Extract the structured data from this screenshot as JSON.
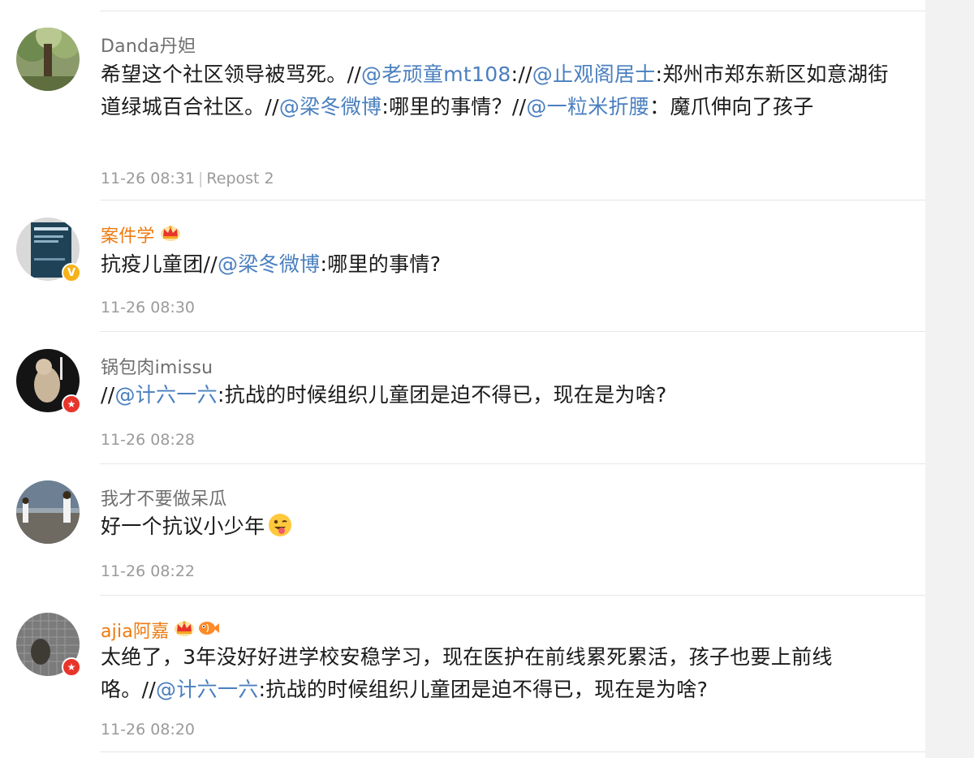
{
  "comments": [
    {
      "username": "Danda丹妲",
      "segments": [
        {
          "t": "希望这个社区领导被骂死。//",
          "m": false
        },
        {
          "t": "@老顽童mt108",
          "m": true
        },
        {
          "t": "://",
          "m": false
        },
        {
          "t": "@止观阁居士",
          "m": true
        },
        {
          "t": ":郑州市郑东新区如意湖街道绿城百合社区。//",
          "m": false
        },
        {
          "t": "@梁冬微博",
          "m": true
        },
        {
          "t": ":哪里的事情？//",
          "m": false
        },
        {
          "t": "@一粒米折腰",
          "m": true
        },
        {
          "t": "：魔爪伸向了孩子",
          "m": false
        }
      ],
      "timestamp": "11-26 08:31",
      "repost": "Repost 2"
    },
    {
      "username": "案件学",
      "segments": [
        {
          "t": "抗疫儿童团//",
          "m": false
        },
        {
          "t": "@梁冬微博",
          "m": true
        },
        {
          "t": ":哪里的事情?",
          "m": false
        }
      ],
      "timestamp": "11-26 08:30"
    },
    {
      "username": "锅包肉imissu",
      "segments": [
        {
          "t": "//",
          "m": false
        },
        {
          "t": "@计六一六",
          "m": true
        },
        {
          "t": ":抗战的时候组织儿童团是迫不得已，现在是为啥?",
          "m": false
        }
      ],
      "timestamp": "11-26 08:28"
    },
    {
      "username": "我才不要做呆瓜",
      "segments": [
        {
          "t": "好一个抗议小少年",
          "m": false
        }
      ],
      "timestamp": "11-26 08:22"
    },
    {
      "username": "ajia阿嘉",
      "segments": [
        {
          "t": "太绝了，3年没好好进学校安稳学习，现在医护在前线累死累活，孩子也要上前线咯。//",
          "m": false
        },
        {
          "t": "@计六一六",
          "m": true
        },
        {
          "t": ":抗战的时候组织儿童团是迫不得已，现在是为啥?",
          "m": false
        }
      ],
      "timestamp": "11-26 08:20"
    }
  ],
  "badges": {
    "verified": "V",
    "red": "★"
  },
  "icons": {
    "crown": "crown-icon",
    "fish": "fish-icon",
    "emoji": "tongue-wink-emoji"
  },
  "colors": {
    "mention": "#4a7fbf",
    "vip_name": "#ee7a10",
    "normal_name": "#6f6f6f",
    "meta": "#9a9a9a"
  }
}
